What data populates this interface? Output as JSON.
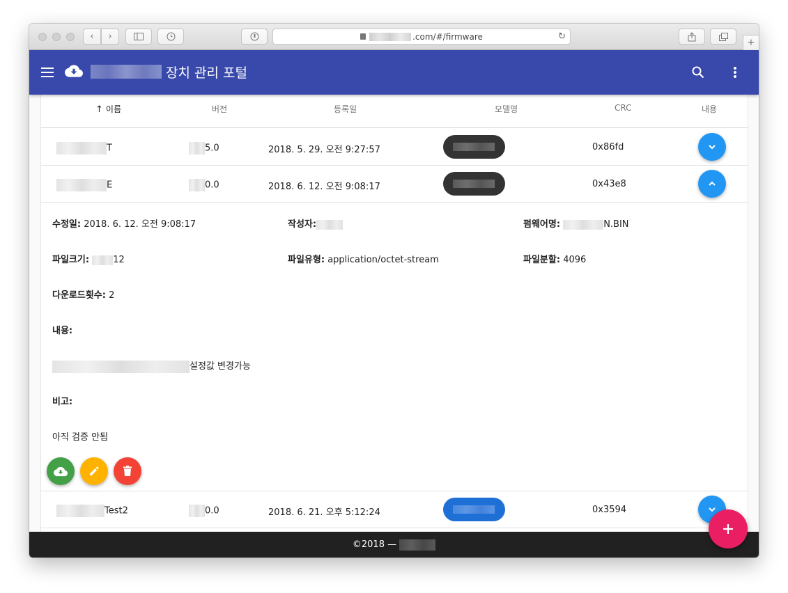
{
  "browser": {
    "url_visible": ".com/#/firmware"
  },
  "appbar": {
    "title": "장치 관리 포털",
    "color": "#3949ab"
  },
  "table": {
    "headers": {
      "name": "이름",
      "version": "버전",
      "registered": "등록일",
      "model": "모델명",
      "crc": "CRC",
      "content": "내용"
    },
    "rows": [
      {
        "name_suffix": "T",
        "version_suffix": "5.0",
        "date": "2018. 5. 29. 오전 9:27:57",
        "crc": "0x86fd"
      },
      {
        "name_suffix": "E",
        "version_suffix": "0.0",
        "date": "2018. 6. 12. 오전 9:08:17",
        "crc": "0x43e8"
      },
      {
        "name_suffix": "Test2",
        "version_suffix": "0.0",
        "date": "2018. 6. 21. 오후 5:12:24",
        "crc": "0x3594"
      }
    ]
  },
  "detail": {
    "modified_label": "수정일:",
    "modified_value": "2018. 6. 12. 오전 9:08:17",
    "author_label": "작성자:",
    "firmware_name_label": "펌웨어명:",
    "firmware_name_suffix": "N.BIN",
    "filesize_label": "파일크기:",
    "filesize_suffix": "12",
    "filetype_label": "파일유형:",
    "filetype_value": "application/octet-stream",
    "split_label": "파일분할:",
    "split_value": "4096",
    "downloads_label": "다운로드횟수:",
    "downloads_value": "2",
    "content_label": "내용:",
    "content_suffix": "설정값 변경가능",
    "note_label": "비고:",
    "note_value": "아직 검증 안됨"
  },
  "footer": {
    "text": "©2018 —"
  },
  "colors": {
    "accent_blue": "#2196f3",
    "fab_pink": "#e91e63",
    "download_green": "#43a047",
    "edit_amber": "#ffb300",
    "delete_red": "#f44336"
  }
}
